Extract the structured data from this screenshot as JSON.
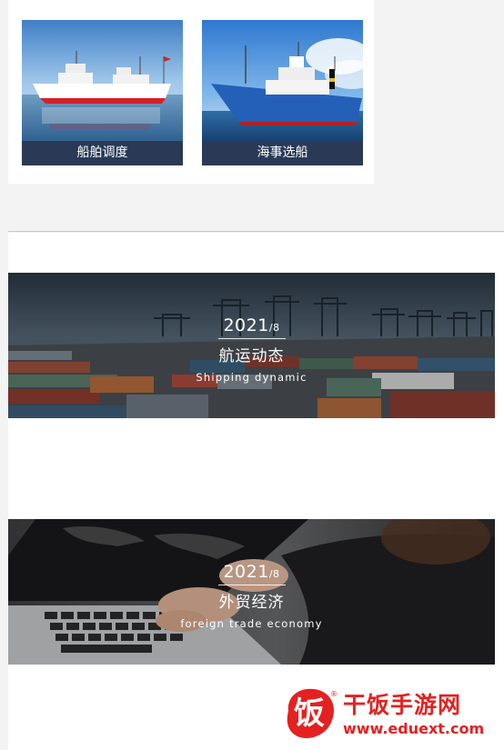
{
  "ships": [
    {
      "caption": "船舶调度"
    },
    {
      "caption": "海事选船"
    }
  ],
  "banners": [
    {
      "year": "2021",
      "month": "/8",
      "title": "航运动态",
      "subtitle": "Shipping dynamic"
    },
    {
      "year": "2021",
      "month": "/8",
      "title": "外贸经济",
      "subtitle": "foreign trade economy"
    }
  ],
  "watermark": {
    "name": "干饭手游网",
    "url": "www.eduext.com",
    "glyph": "饭"
  },
  "colors": {
    "caption_bar": "#2a3a56",
    "watermark_red": "#e52020"
  }
}
